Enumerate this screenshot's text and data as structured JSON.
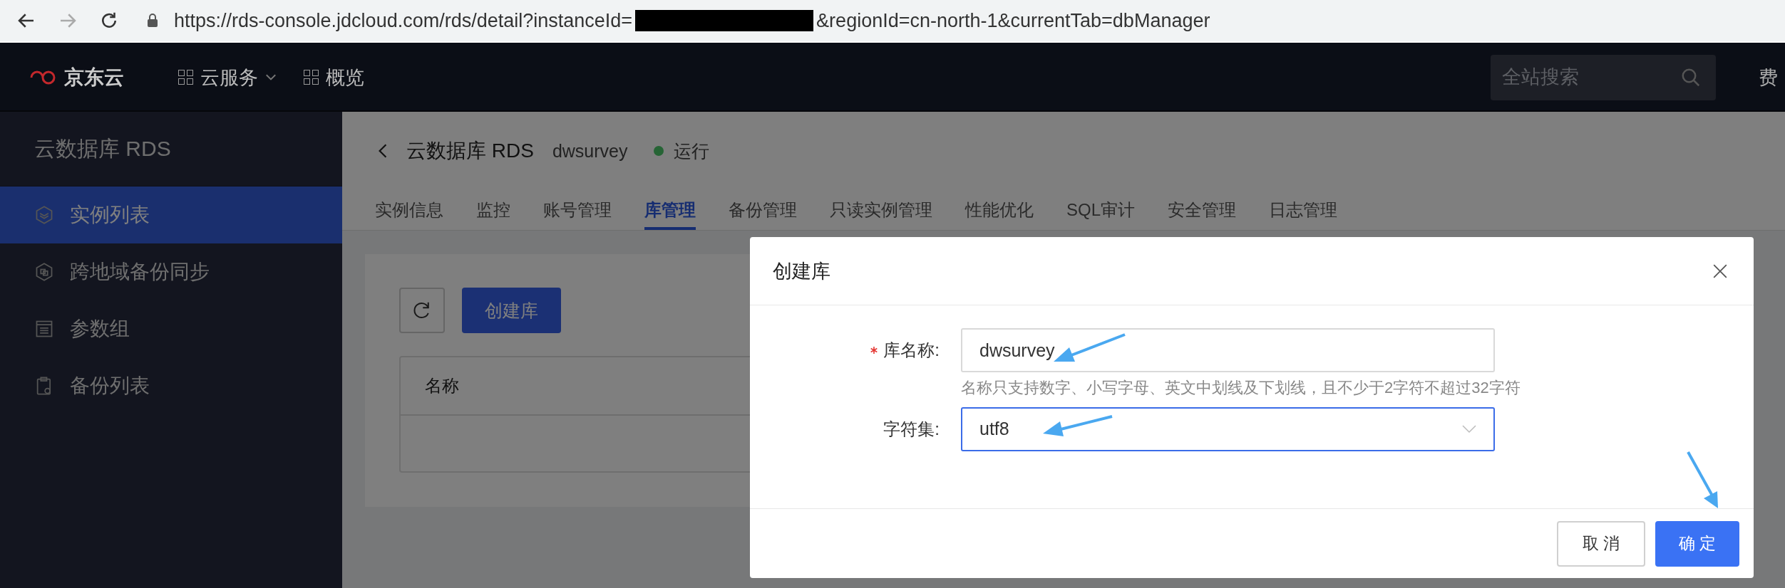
{
  "browser": {
    "url_before": "https://rds-console.jdcloud.com/rds/detail?instanceId=",
    "url_after": "&regionId=cn-north-1&currentTab=dbManager",
    "forward_disabled": true
  },
  "topnav": {
    "logo": "京东云",
    "menu": [
      {
        "label": "云服务",
        "dropdown": true
      },
      {
        "label": "概览",
        "dropdown": false
      }
    ],
    "search": {
      "placeholder": "全站搜索"
    },
    "right_link": "费"
  },
  "sidebar": {
    "title": "云数据库 RDS",
    "items": [
      {
        "label": "实例列表",
        "selected": true
      },
      {
        "label": "跨地域备份同步",
        "selected": false
      },
      {
        "label": "参数组",
        "selected": false
      },
      {
        "label": "备份列表",
        "selected": false
      }
    ]
  },
  "header": {
    "title": "云数据库 RDS",
    "instance": "dwsurvey",
    "status": "运行"
  },
  "tabs": [
    {
      "label": "实例信息",
      "selected": false
    },
    {
      "label": "监控",
      "selected": false
    },
    {
      "label": "账号管理",
      "selected": false
    },
    {
      "label": "库管理",
      "selected": true
    },
    {
      "label": "备份管理",
      "selected": false
    },
    {
      "label": "只读实例管理",
      "selected": false
    },
    {
      "label": "性能优化",
      "selected": false
    },
    {
      "label": "SQL审计",
      "selected": false
    },
    {
      "label": "安全管理",
      "selected": false
    },
    {
      "label": "日志管理",
      "selected": false
    }
  ],
  "toolbar": {
    "create_button": "创建库"
  },
  "table": {
    "columns": [
      "名称"
    ]
  },
  "dialog": {
    "title": "创建库",
    "fields": [
      {
        "kind": "text",
        "label": "库名称:",
        "required": true,
        "value": "dwsurvey",
        "focused": false,
        "hint": "名称只支持数字、小写字母、英文中划线及下划线，且不少于2字符不超过32字符"
      },
      {
        "kind": "select",
        "label": "字符集:",
        "required": false,
        "value": "utf8",
        "focused": true
      }
    ],
    "buttons": [
      {
        "label": "取 消",
        "primary": false
      },
      {
        "label": "确 定",
        "primary": true
      }
    ]
  }
}
